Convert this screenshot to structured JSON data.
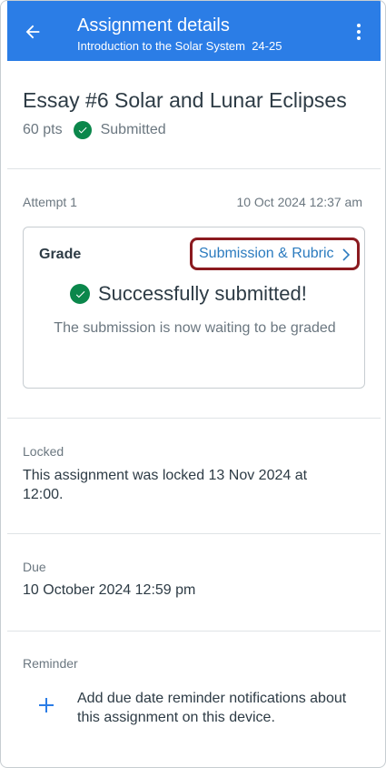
{
  "header": {
    "title": "Assignment details",
    "subtitle": "Introduction to the Solar System  24-25",
    "back_icon": "arrow-left-icon",
    "menu_icon": "more-vertical-icon"
  },
  "assignment": {
    "title": "Essay #6 Solar and Lunar Eclipses",
    "points": "60 pts",
    "status": "Submitted"
  },
  "attempt": {
    "label": "Attempt 1",
    "date": "10 Oct 2024 12:37 am"
  },
  "grade_card": {
    "label": "Grade",
    "link_label": "Submission & Rubric",
    "success_text": "Successfully submitted!",
    "waiting_text": "The submission is now waiting to be graded"
  },
  "locked": {
    "label": "Locked",
    "text": "This assignment was locked 13 Nov 2024 at 12:00."
  },
  "due": {
    "label": "Due",
    "text": "10 October 2024 12:59 pm"
  },
  "reminder": {
    "label": "Reminder",
    "text": "Add due date reminder notifications about this assignment on this device."
  },
  "colors": {
    "app_bar": "#2b7de6",
    "success_green": "#0b874b",
    "link_blue": "#2b7bbf",
    "highlight_border": "#8b1a1f"
  }
}
